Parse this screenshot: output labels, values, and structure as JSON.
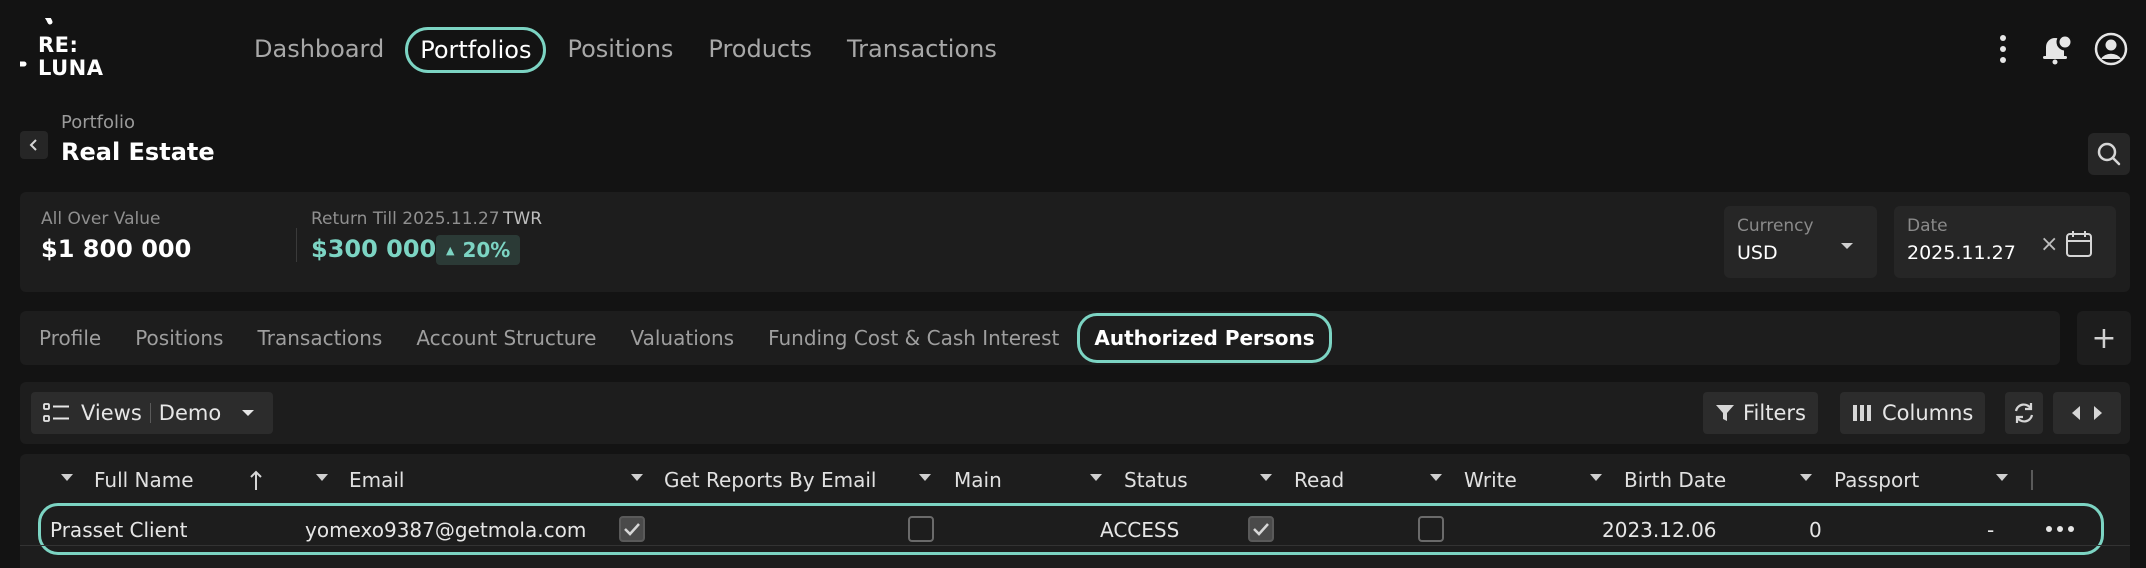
{
  "brand": {
    "line1": "RE:",
    "line2": "LUNA",
    "accent": "#7cd4c3"
  },
  "nav": {
    "items": [
      {
        "label": "Dashboard"
      },
      {
        "label": "Portfolios"
      },
      {
        "label": "Positions"
      },
      {
        "label": "Products"
      },
      {
        "label": "Transactions"
      }
    ],
    "active": "Portfolios"
  },
  "top_icons": [
    "more-vertical-icon",
    "notification-bell-icon",
    "user-avatar-icon"
  ],
  "portfolio": {
    "label": "Portfolio",
    "name": "Real Estate"
  },
  "summary": {
    "all_over_value_label": "All Over Value",
    "all_over_value": "$1 800 000",
    "return_label": "Return Till 2025.11.27",
    "return_type": "TWR",
    "return_value": "$300 000",
    "return_pct": "20%",
    "currency_label": "Currency",
    "currency_value": "USD",
    "date_label": "Date",
    "date_value": "2025.11.27",
    "clear_symbol": "×"
  },
  "tabs": {
    "items": [
      {
        "label": "Profile"
      },
      {
        "label": "Positions"
      },
      {
        "label": "Transactions"
      },
      {
        "label": "Account Structure"
      },
      {
        "label": "Valuations"
      },
      {
        "label": "Funding Cost & Cash Interest"
      },
      {
        "label": "Authorized Persons"
      }
    ],
    "active": "Authorized Persons",
    "add_symbol": "+"
  },
  "toolbar": {
    "views_label": "Views",
    "view_name": "Demo",
    "filters_label": "Filters",
    "columns_label": "Columns"
  },
  "table": {
    "columns": [
      "Full Name",
      "Email",
      "Get Reports By Email",
      "Main",
      "Status",
      "Read",
      "Write",
      "Birth Date",
      "Passport"
    ],
    "rows": [
      {
        "full_name": "Prasset Client",
        "email": "yomexo9387@getmola.com",
        "get_reports_by_email": true,
        "main": false,
        "status": "ACCESS",
        "read": true,
        "write": false,
        "birth_date": "2023.12.06",
        "passport": "0",
        "extra": "-"
      }
    ]
  }
}
